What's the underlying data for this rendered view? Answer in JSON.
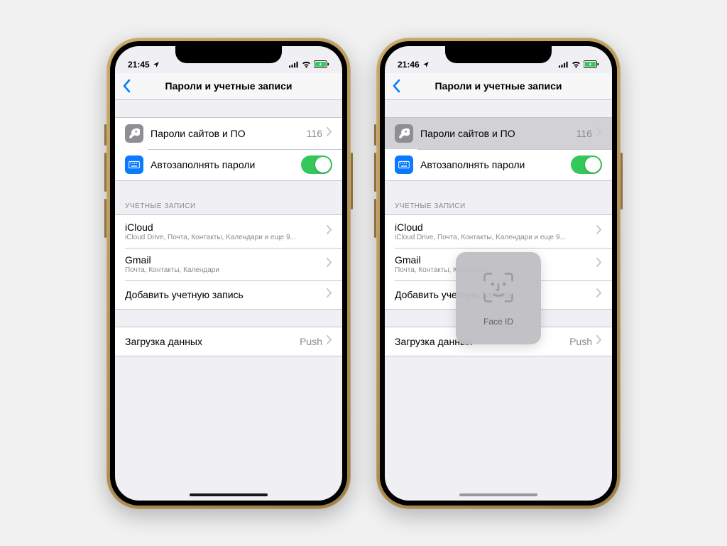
{
  "phone1": {
    "status": {
      "time": "21:45"
    },
    "nav": {
      "title": "Пароли и учетные записи"
    },
    "passwords": {
      "site_passwords_label": "Пароли сайтов и ПО",
      "site_passwords_count": "116",
      "autofill_label": "Автозаполнять пароли"
    },
    "accounts_header": "УЧЕТНЫЕ ЗАПИСИ",
    "accounts": {
      "icloud": {
        "title": "iCloud",
        "subtitle": "iCloud Drive, Почта, Контакты, Kалендари и еще 9..."
      },
      "gmail": {
        "title": "Gmail",
        "subtitle": "Почта, Контакты, Календари"
      },
      "add": {
        "title": "Добавить учетную запись"
      }
    },
    "fetch": {
      "label": "Загрузка данных",
      "value": "Push"
    }
  },
  "phone2": {
    "status": {
      "time": "21:46"
    },
    "nav": {
      "title": "Пароли и учетные записи"
    },
    "passwords": {
      "site_passwords_label": "Пароли сайтов и ПО",
      "site_passwords_count": "116",
      "autofill_label": "Автозаполнять пароли"
    },
    "accounts_header": "УЧЕТНЫЕ ЗАПИСИ",
    "accounts": {
      "icloud": {
        "title": "iCloud",
        "subtitle": "iCloud Drive, Почта, Контакты, Kалендари и еще 9..."
      },
      "gmail": {
        "title": "Gmail",
        "subtitle": "Почта, Контакты, Календари"
      },
      "add": {
        "title": "Добавить учетную запись"
      }
    },
    "fetch": {
      "label": "Загрузка данных",
      "value": "Push"
    },
    "faceid_label": "Face ID"
  }
}
